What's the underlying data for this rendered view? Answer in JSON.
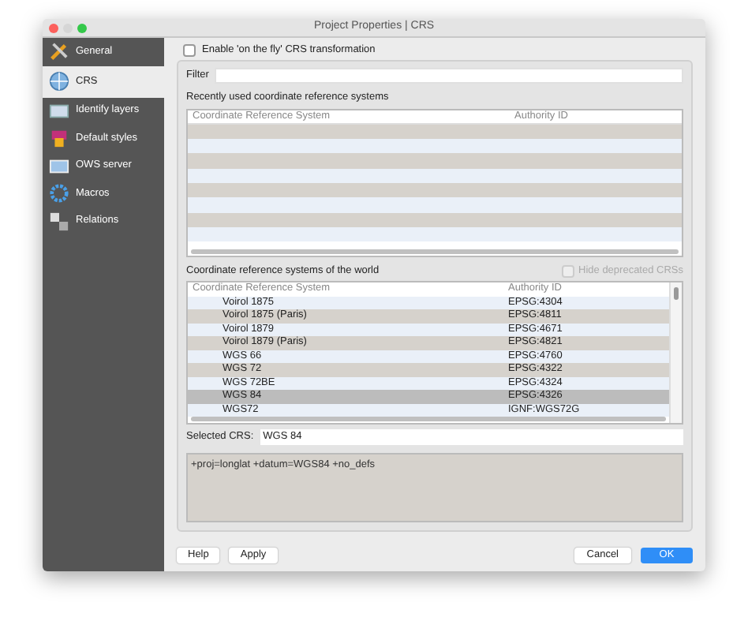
{
  "window": {
    "title": "Project Properties | CRS"
  },
  "sidebar": {
    "items": [
      {
        "label": "General",
        "selected": false,
        "kind": "general"
      },
      {
        "label": "CRS",
        "selected": true,
        "kind": "crs"
      },
      {
        "label": "Identify layers",
        "selected": false,
        "kind": "identify"
      },
      {
        "label": "Default styles",
        "selected": false,
        "kind": "styles"
      },
      {
        "label": "OWS server",
        "selected": false,
        "kind": "ows"
      },
      {
        "label": "Macros",
        "selected": false,
        "kind": "macros"
      },
      {
        "label": "Relations",
        "selected": false,
        "kind": "relations"
      }
    ]
  },
  "on_the_fly": {
    "label": "Enable 'on the fly' CRS transformation",
    "checked": false
  },
  "filter": {
    "label": "Filter"
  },
  "recent": {
    "label": "Recently used coordinate reference systems",
    "columns": [
      "Coordinate Reference System",
      "Authority ID"
    ]
  },
  "world": {
    "label": "Coordinate reference systems of the world",
    "hide_deprecated": {
      "label": "Hide deprecated CRSs",
      "checked": false,
      "disabled": true
    },
    "columns": [
      "Coordinate Reference System",
      "Authority ID"
    ],
    "rows": [
      {
        "name": "Voirol 1875",
        "id": "EPSG:4304",
        "selected": false
      },
      {
        "name": "Voirol 1875 (Paris)",
        "id": "EPSG:4811",
        "selected": false
      },
      {
        "name": "Voirol 1879",
        "id": "EPSG:4671",
        "selected": false
      },
      {
        "name": "Voirol 1879 (Paris)",
        "id": "EPSG:4821",
        "selected": false
      },
      {
        "name": "WGS 66",
        "id": "EPSG:4760",
        "selected": false
      },
      {
        "name": "WGS 72",
        "id": "EPSG:4322",
        "selected": false
      },
      {
        "name": "WGS 72BE",
        "id": "EPSG:4324",
        "selected": false
      },
      {
        "name": "WGS 84",
        "id": "EPSG:4326",
        "selected": true
      },
      {
        "name": "WGS72",
        "id": "IGNF:WGS72G",
        "selected": false
      }
    ]
  },
  "selected_crs": {
    "label": "Selected CRS:",
    "value": "WGS 84"
  },
  "proj_string": "+proj=longlat +datum=WGS84 +no_defs",
  "buttons": {
    "left": [
      "Help",
      "Apply"
    ],
    "cancel": "Cancel",
    "ok": "OK"
  }
}
